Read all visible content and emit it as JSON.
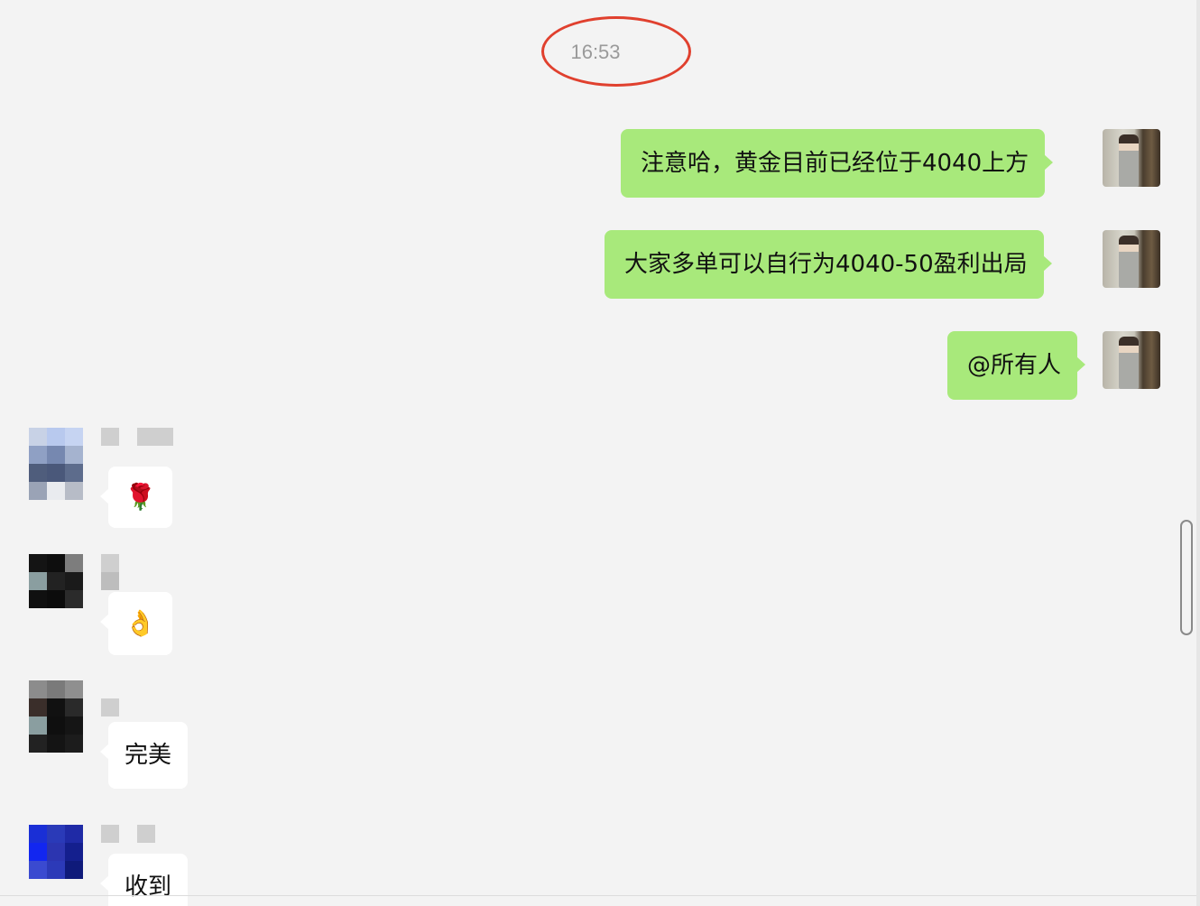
{
  "timestamp": "16:53",
  "outgoing_messages": [
    {
      "text": "注意哈，黄金目前已经位于4040上方"
    },
    {
      "text": "大家多单可以自行为4040-50盈利出局"
    },
    {
      "text": "@所有人"
    }
  ],
  "incoming_messages": [
    {
      "text": "🌹",
      "kind": "emoji"
    },
    {
      "text": "👌",
      "kind": "emoji"
    },
    {
      "text": "完美",
      "kind": "text"
    },
    {
      "text": "收到",
      "kind": "text"
    }
  ],
  "colors": {
    "background": "#f3f3f3",
    "outgoing_bubble": "#a8e97b",
    "incoming_bubble": "#ffffff",
    "highlight_circle": "#e0402e",
    "timestamp_text": "#9a9a9a"
  },
  "icons": {
    "self_avatar": "user-avatar-icon",
    "other_avatar": "pixelated-avatar-icon",
    "redacted_name": "pixelated-name-blocks"
  }
}
